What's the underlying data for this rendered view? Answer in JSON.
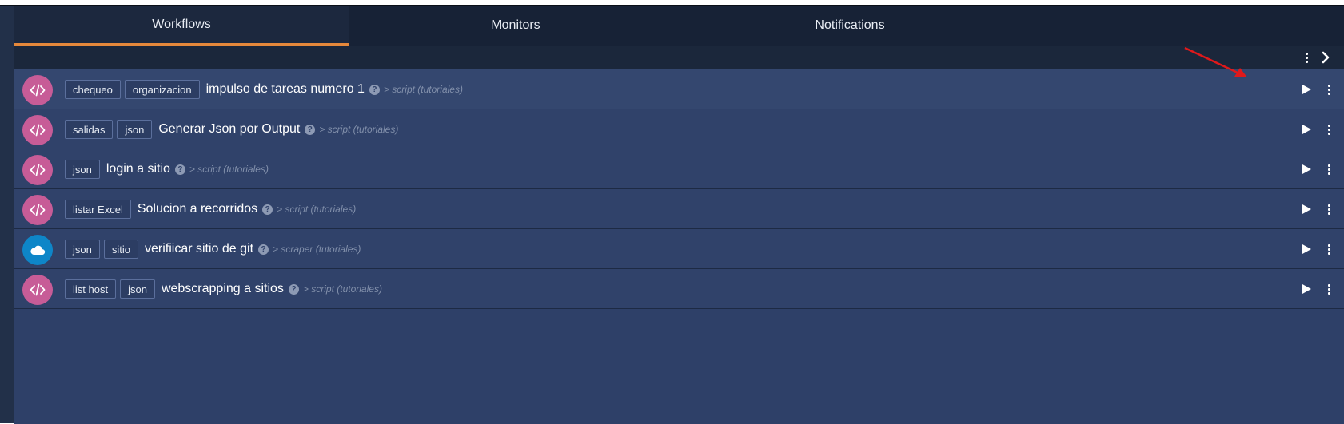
{
  "tabs": [
    {
      "label": "Workflows",
      "active": true
    },
    {
      "label": "Monitors",
      "active": false
    },
    {
      "label": "Notifications",
      "active": false
    }
  ],
  "toolbar": {
    "icons": [
      "kebab-menu-icon",
      "chevron-right-icon"
    ]
  },
  "workflows": [
    {
      "type": "script",
      "icon": "code-icon",
      "tags": [
        "chequeo",
        "organizacion"
      ],
      "name": "impulso de tareas numero 1",
      "help": "?",
      "meta": "> script (tutoriales)"
    },
    {
      "type": "script",
      "icon": "code-icon",
      "tags": [
        "salidas",
        "json"
      ],
      "name": "Generar Json por Output",
      "help": "?",
      "meta": "> script (tutoriales)"
    },
    {
      "type": "script",
      "icon": "code-icon",
      "tags": [
        "json"
      ],
      "name": "login a sitio",
      "help": "?",
      "meta": "> script (tutoriales)"
    },
    {
      "type": "script",
      "icon": "code-icon",
      "tags": [
        "listar Excel"
      ],
      "name": "Solucion a recorridos",
      "help": "?",
      "meta": "> script (tutoriales)"
    },
    {
      "type": "scraper",
      "icon": "cloud-icon",
      "tags": [
        "json",
        "sitio"
      ],
      "name": "verifiicar sitio de git",
      "help": "?",
      "meta": "> scraper (tutoriales)"
    },
    {
      "type": "script",
      "icon": "code-icon",
      "tags": [
        "list host",
        "json"
      ],
      "name": "webscrapping a sitios",
      "help": "?",
      "meta": "> script (tutoriales)"
    }
  ],
  "colors": {
    "accent": "#e5883b",
    "script_badge": "#c75c97",
    "scraper_badge": "#0e86c8",
    "annotation_arrow": "#e0191b"
  }
}
